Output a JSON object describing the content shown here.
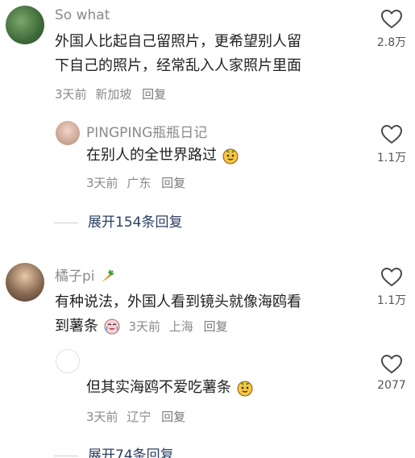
{
  "comments": [
    {
      "author": "So what",
      "text_line1": "外国人比起自己留照片，更希望别人留",
      "text_line2": "下自己的照片，经常乱入人家照片里面",
      "time": "3天前",
      "location": "新加坡",
      "reply_label": "回复",
      "likes": "2.8万",
      "replies": [
        {
          "author": "PINGPING瓶瓶日记",
          "text": "在别人的全世界路过",
          "time": "3天前",
          "location": "广东",
          "reply_label": "回复",
          "likes": "1.1万"
        }
      ],
      "expand_label": "展开154条回复"
    },
    {
      "author": "橘子pi",
      "text_line1": "有种说法，外国人看到镜头就像海鸥看",
      "text_line2": "到薯条",
      "time": "3天前",
      "location": "上海",
      "reply_label": "回复",
      "likes": "1.1万",
      "replies": [
        {
          "author": "",
          "text": "但其实海鸥不爱吃薯条",
          "time": "3天前",
          "location": "辽宁",
          "reply_label": "回复",
          "likes": "2077"
        }
      ],
      "expand_label": "展开74条回复"
    }
  ],
  "icons": {
    "like": "heart-outline-icon",
    "emoji_1": "emoji-face-icon",
    "emoji_2": "emoji-crying-icon",
    "carrot": "carrot-icon"
  },
  "colors": {
    "muted": "#8a8a8a",
    "text": "#1f1f1f",
    "link": "#2b3e63"
  }
}
